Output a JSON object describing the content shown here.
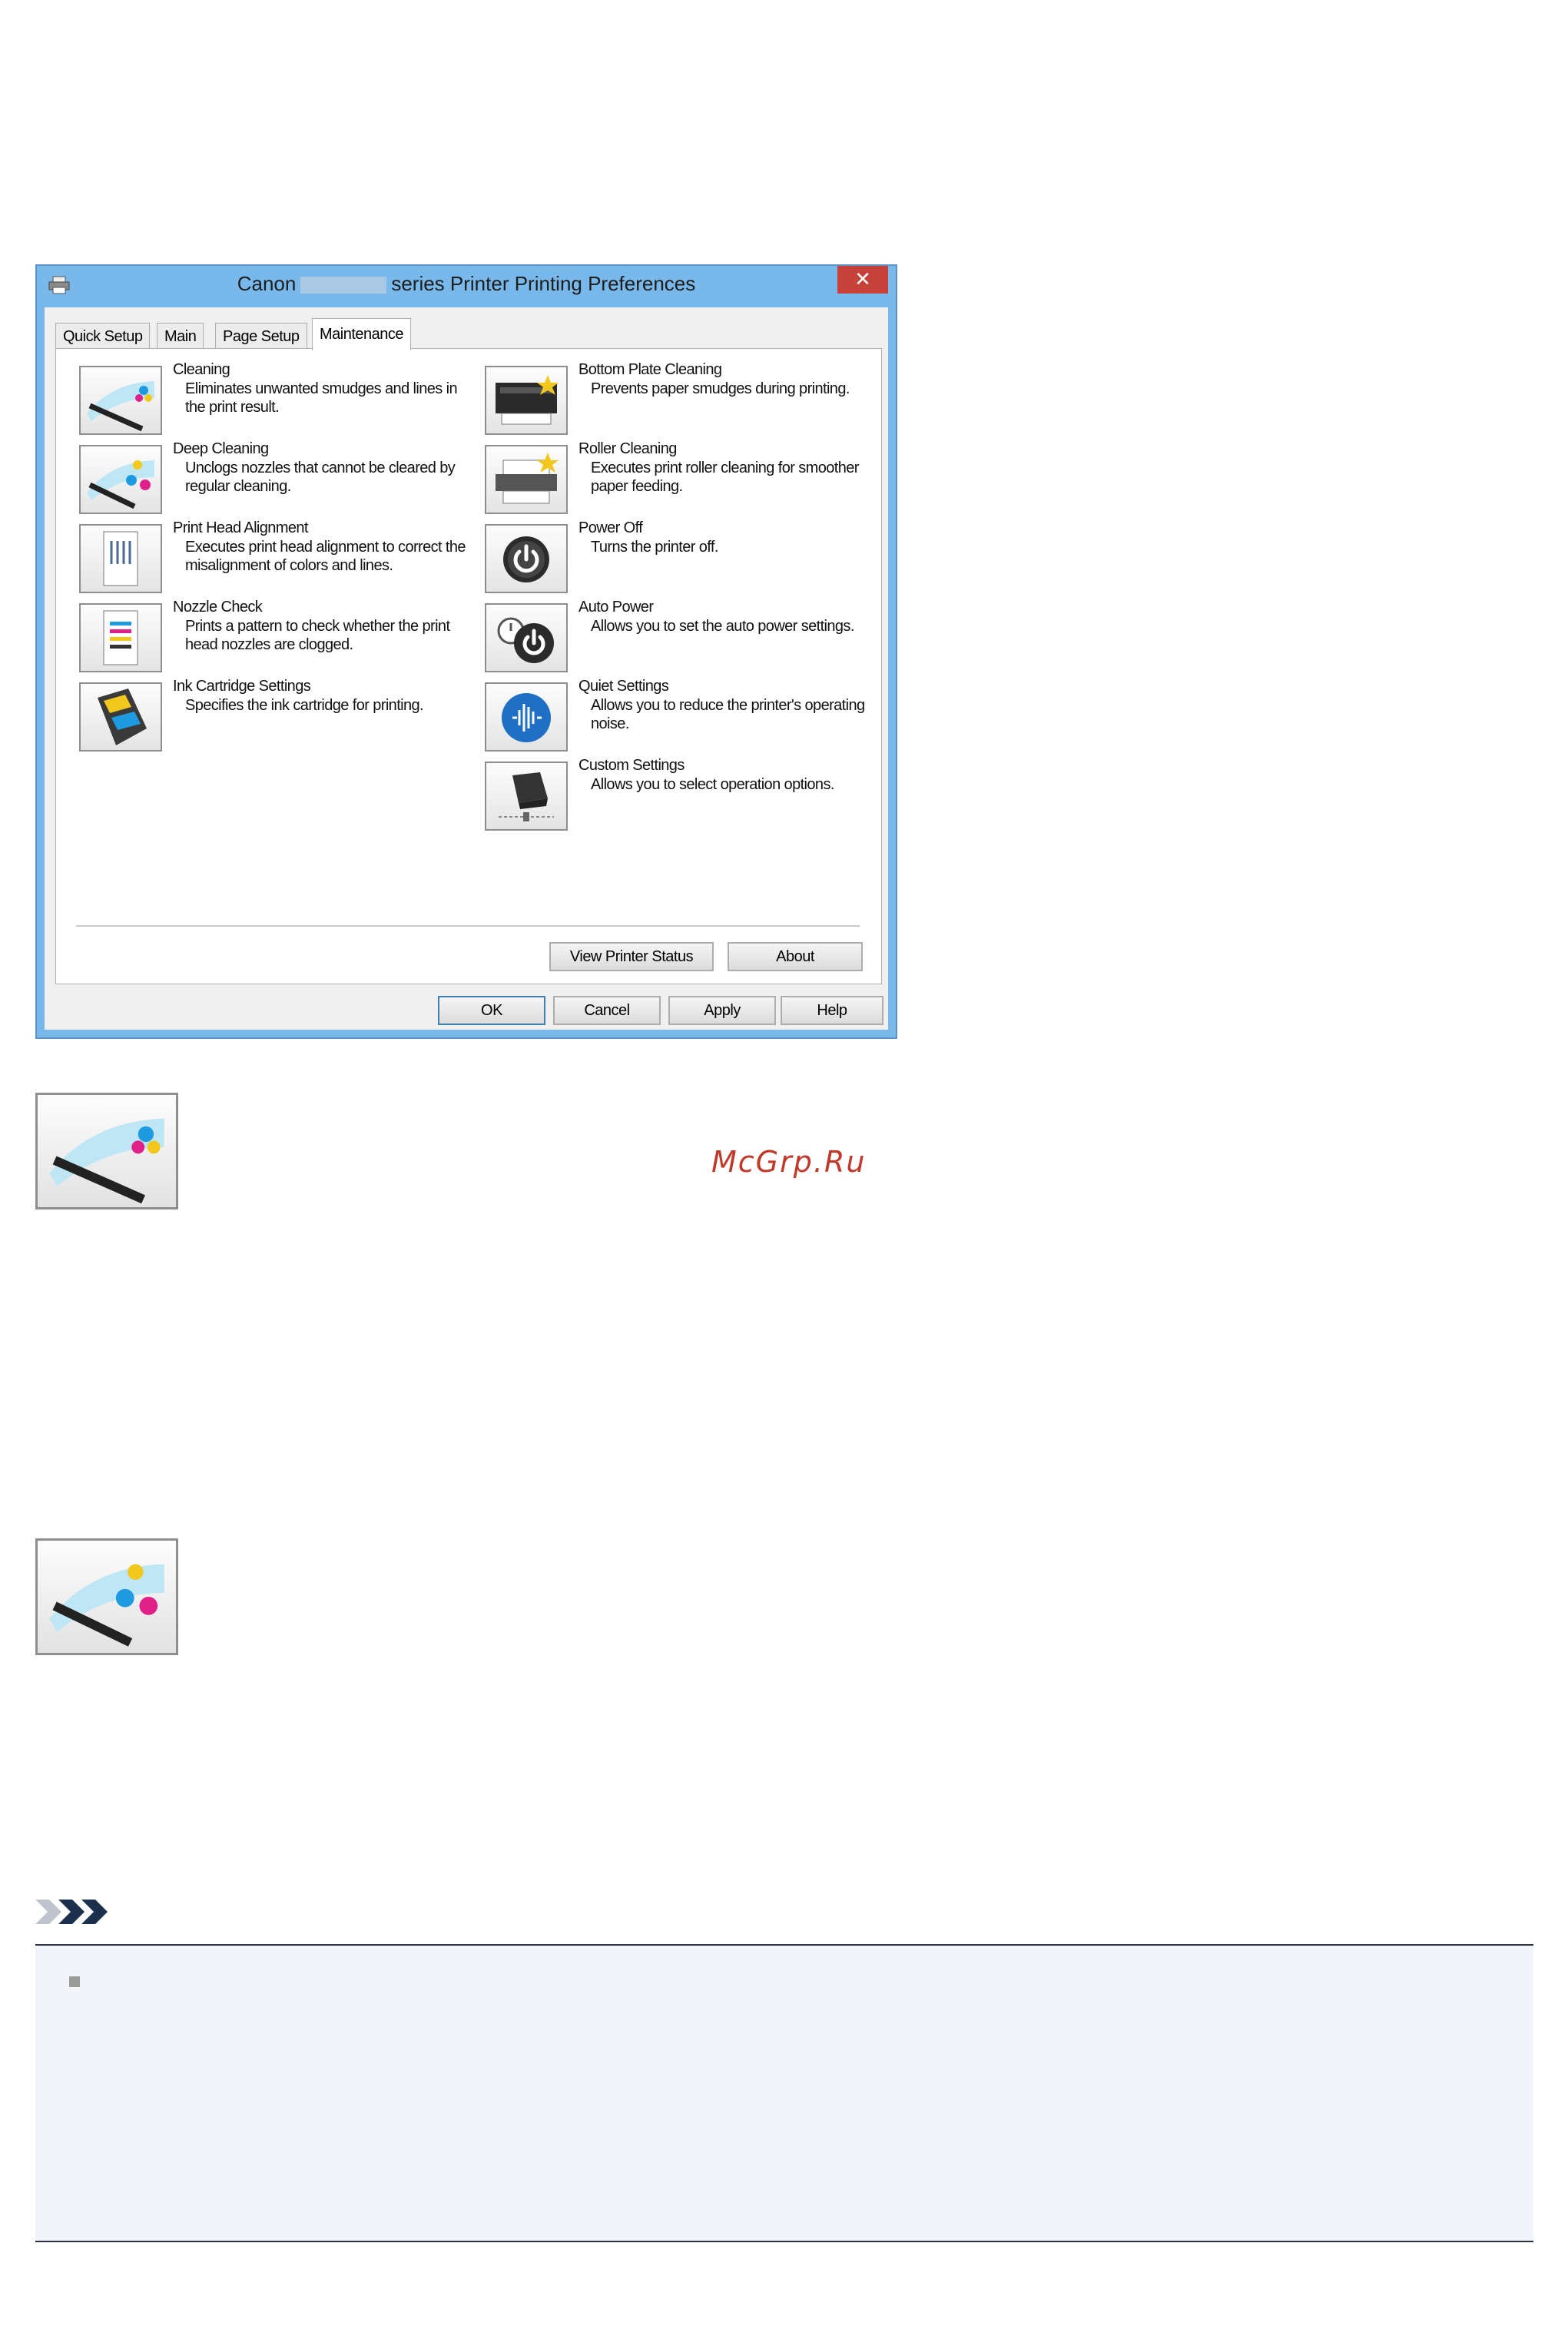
{
  "window": {
    "title_prefix": "Canon",
    "title_suffix": "series Printer Printing Preferences",
    "close_label": "✕"
  },
  "tabs": [
    {
      "label": "Quick Setup"
    },
    {
      "label": "Main"
    },
    {
      "label": "Page Setup"
    },
    {
      "label": "Maintenance",
      "active": true
    }
  ],
  "maintenance": {
    "left_items": [
      {
        "name": "Cleaning",
        "description": "Eliminates unwanted smudges and lines in the print result.",
        "icon": "cleaning-icon"
      },
      {
        "name": "Deep Cleaning",
        "description": "Unclogs nozzles that cannot be cleared by regular cleaning.",
        "icon": "deep-cleaning-icon"
      },
      {
        "name": "Print Head Alignment",
        "description": "Executes print head alignment to correct the misalignment of colors and lines.",
        "icon": "print-head-alignment-icon"
      },
      {
        "name": "Nozzle Check",
        "description": "Prints a pattern to check whether the print head nozzles are clogged.",
        "icon": "nozzle-check-icon"
      },
      {
        "name": "Ink Cartridge Settings",
        "description": "Specifies the ink cartridge for printing.",
        "icon": "ink-cartridge-icon"
      }
    ],
    "right_items": [
      {
        "name": "Bottom Plate Cleaning",
        "description": "Prevents paper smudges during printing.",
        "icon": "bottom-plate-cleaning-icon"
      },
      {
        "name": "Roller Cleaning",
        "description": "Executes print roller cleaning for smoother paper feeding.",
        "icon": "roller-cleaning-icon"
      },
      {
        "name": "Power Off",
        "description": "Turns the printer off.",
        "icon": "power-off-icon"
      },
      {
        "name": "Auto Power",
        "description": "Allows you to set the auto power settings.",
        "icon": "auto-power-icon"
      },
      {
        "name": "Quiet Settings",
        "description": "Allows you to reduce the printer's operating noise.",
        "icon": "quiet-settings-icon"
      },
      {
        "name": "Custom Settings",
        "description": "Allows you to select operation options.",
        "icon": "custom-settings-icon"
      }
    ],
    "view_printer_status_label": "View Printer Status",
    "about_label": "About"
  },
  "footer": {
    "ok_label": "OK",
    "cancel_label": "Cancel",
    "apply_label": "Apply",
    "help_label": "Help"
  },
  "watermark": "McGrp.Ru",
  "colors": {
    "window_frame": "#79b8ea",
    "close_button": "#c7413b",
    "accent_blue": "#1f5fa8",
    "watermark": "#c0392b",
    "note_background": "#f3f4f9",
    "note_icon": "#1d2f4e"
  }
}
